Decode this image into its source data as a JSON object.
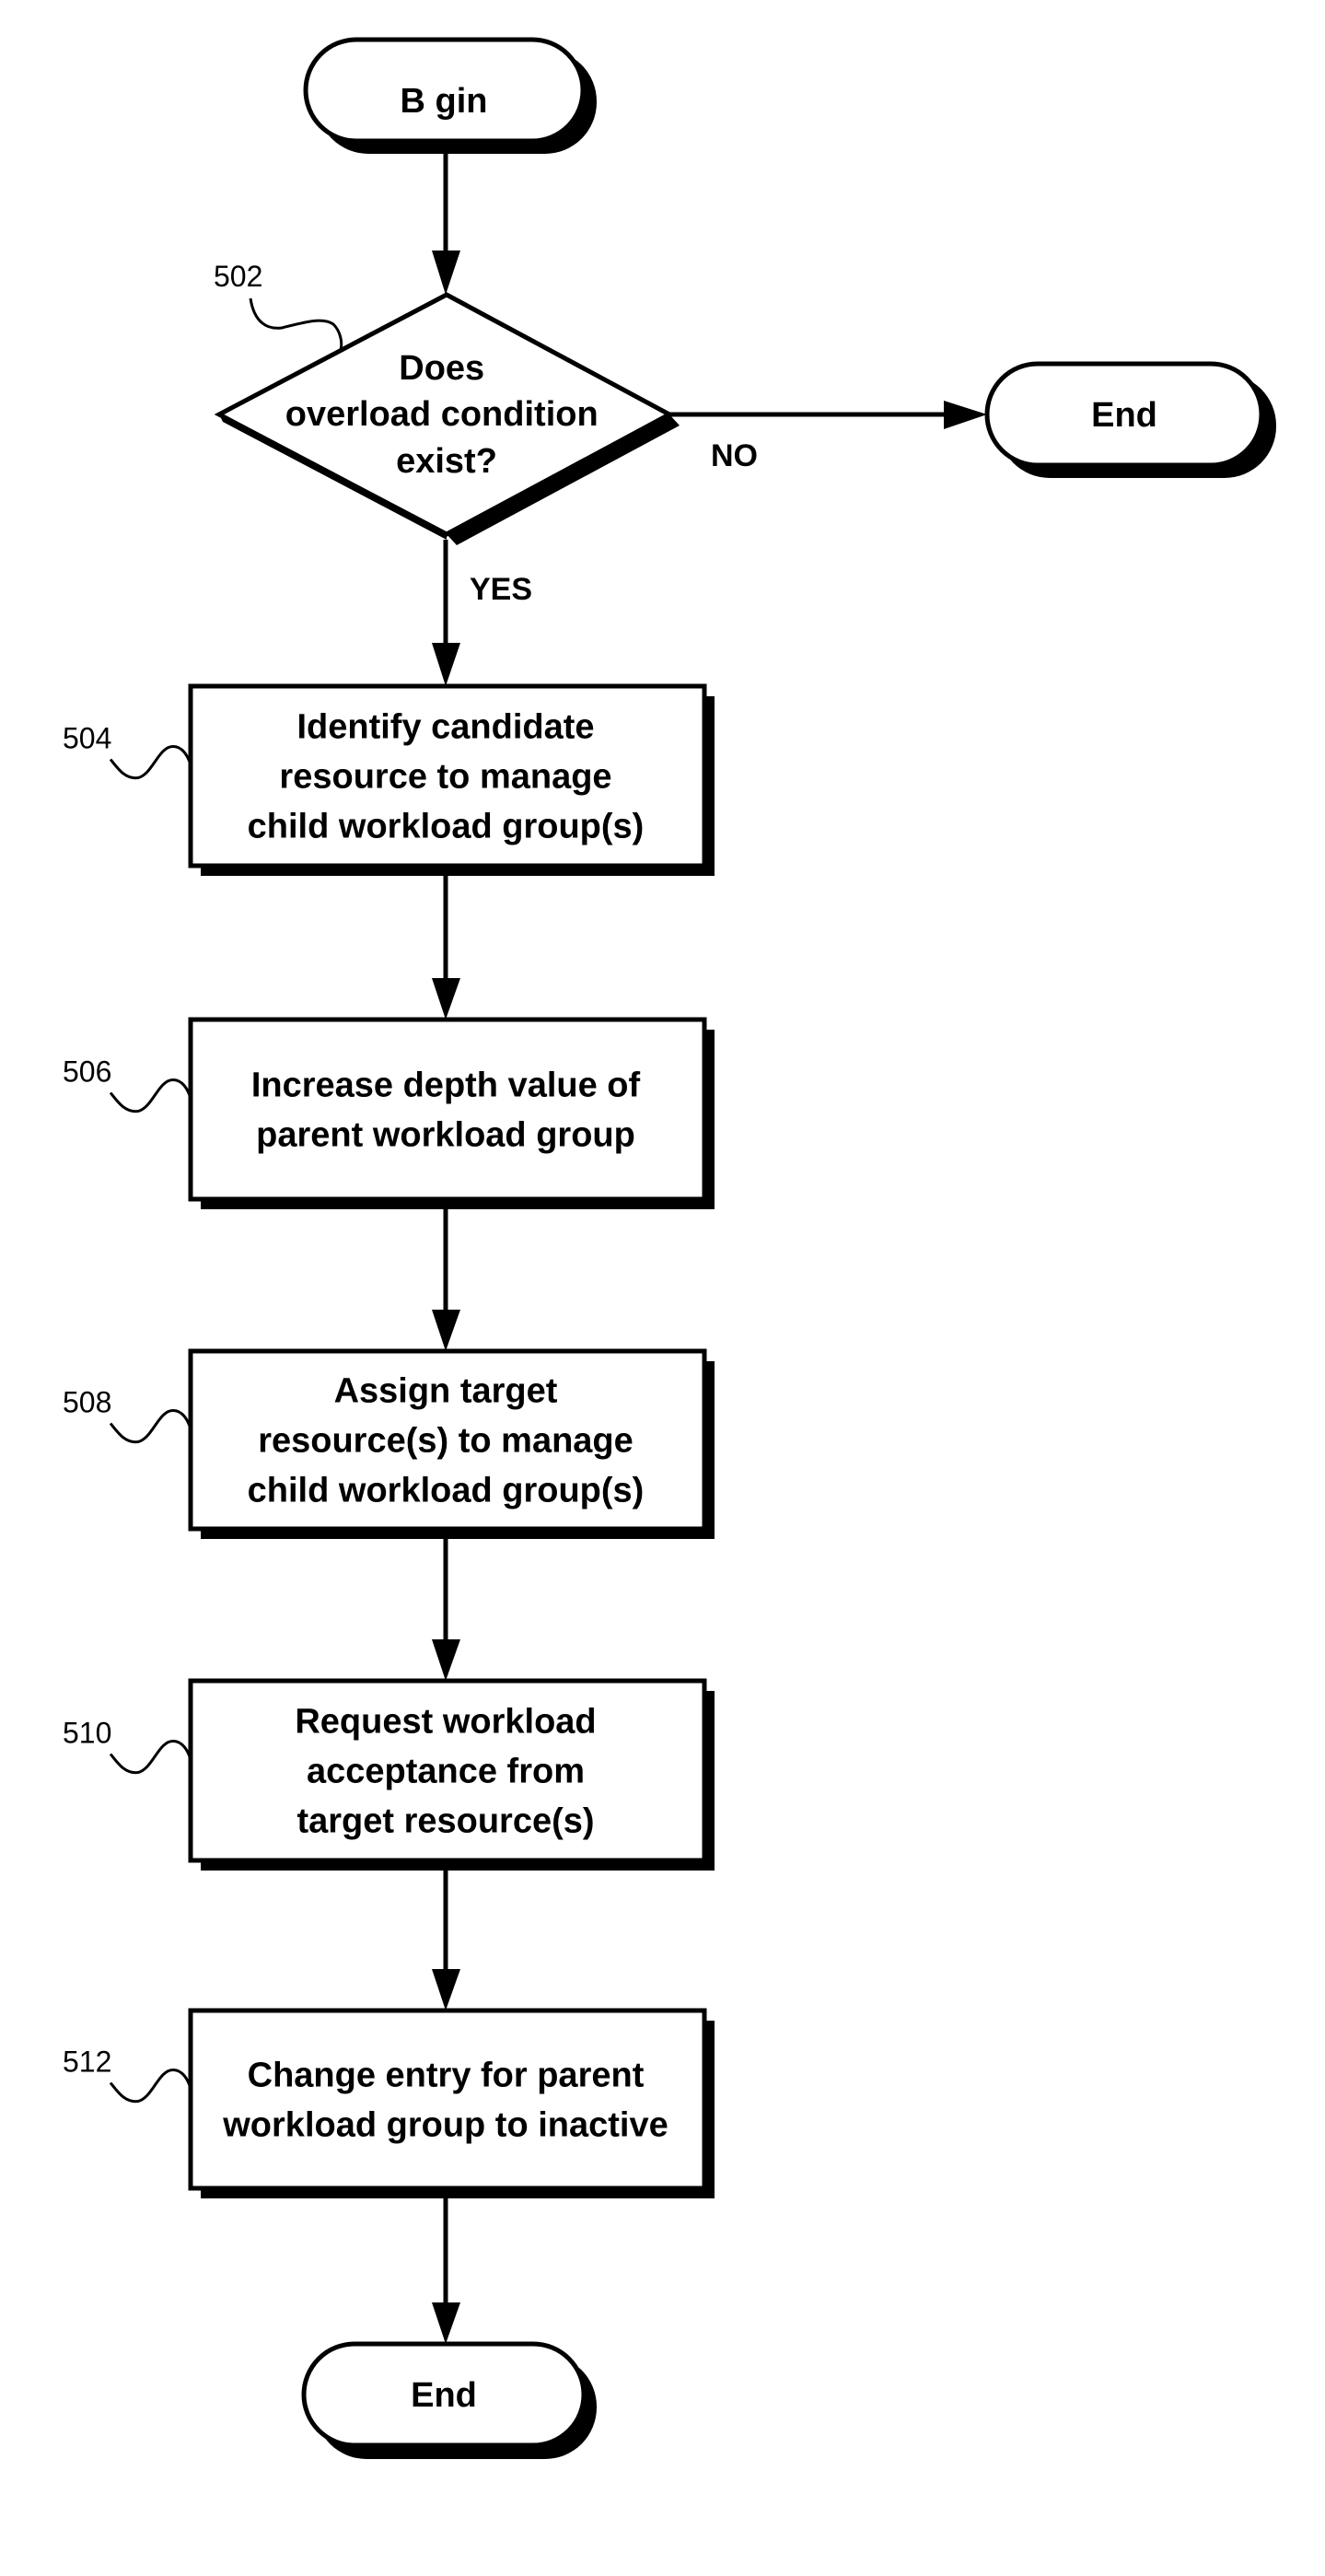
{
  "figure": {
    "start": {
      "id": "begin",
      "label": "B gin"
    },
    "decision": {
      "ref": "502",
      "lines": [
        "Does",
        "overload condition",
        "exist?"
      ],
      "yes_label": "YES",
      "no_label": "NO",
      "no_target": {
        "label": "End"
      }
    },
    "steps": [
      {
        "ref": "504",
        "lines": [
          "Identify candidate",
          "resource to manage",
          "child workload group(s)"
        ]
      },
      {
        "ref": "506",
        "lines": [
          "Increase depth value of",
          "parent workload group"
        ]
      },
      {
        "ref": "508",
        "lines": [
          "Assign target",
          "resource(s) to manage",
          "child workload group(s)"
        ]
      },
      {
        "ref": "510",
        "lines": [
          "Request workload",
          "acceptance from",
          "target resource(s)"
        ]
      },
      {
        "ref": "512",
        "lines": [
          "Change entry for parent",
          "workload group to inactive"
        ]
      }
    ],
    "end": {
      "label": "End"
    }
  }
}
